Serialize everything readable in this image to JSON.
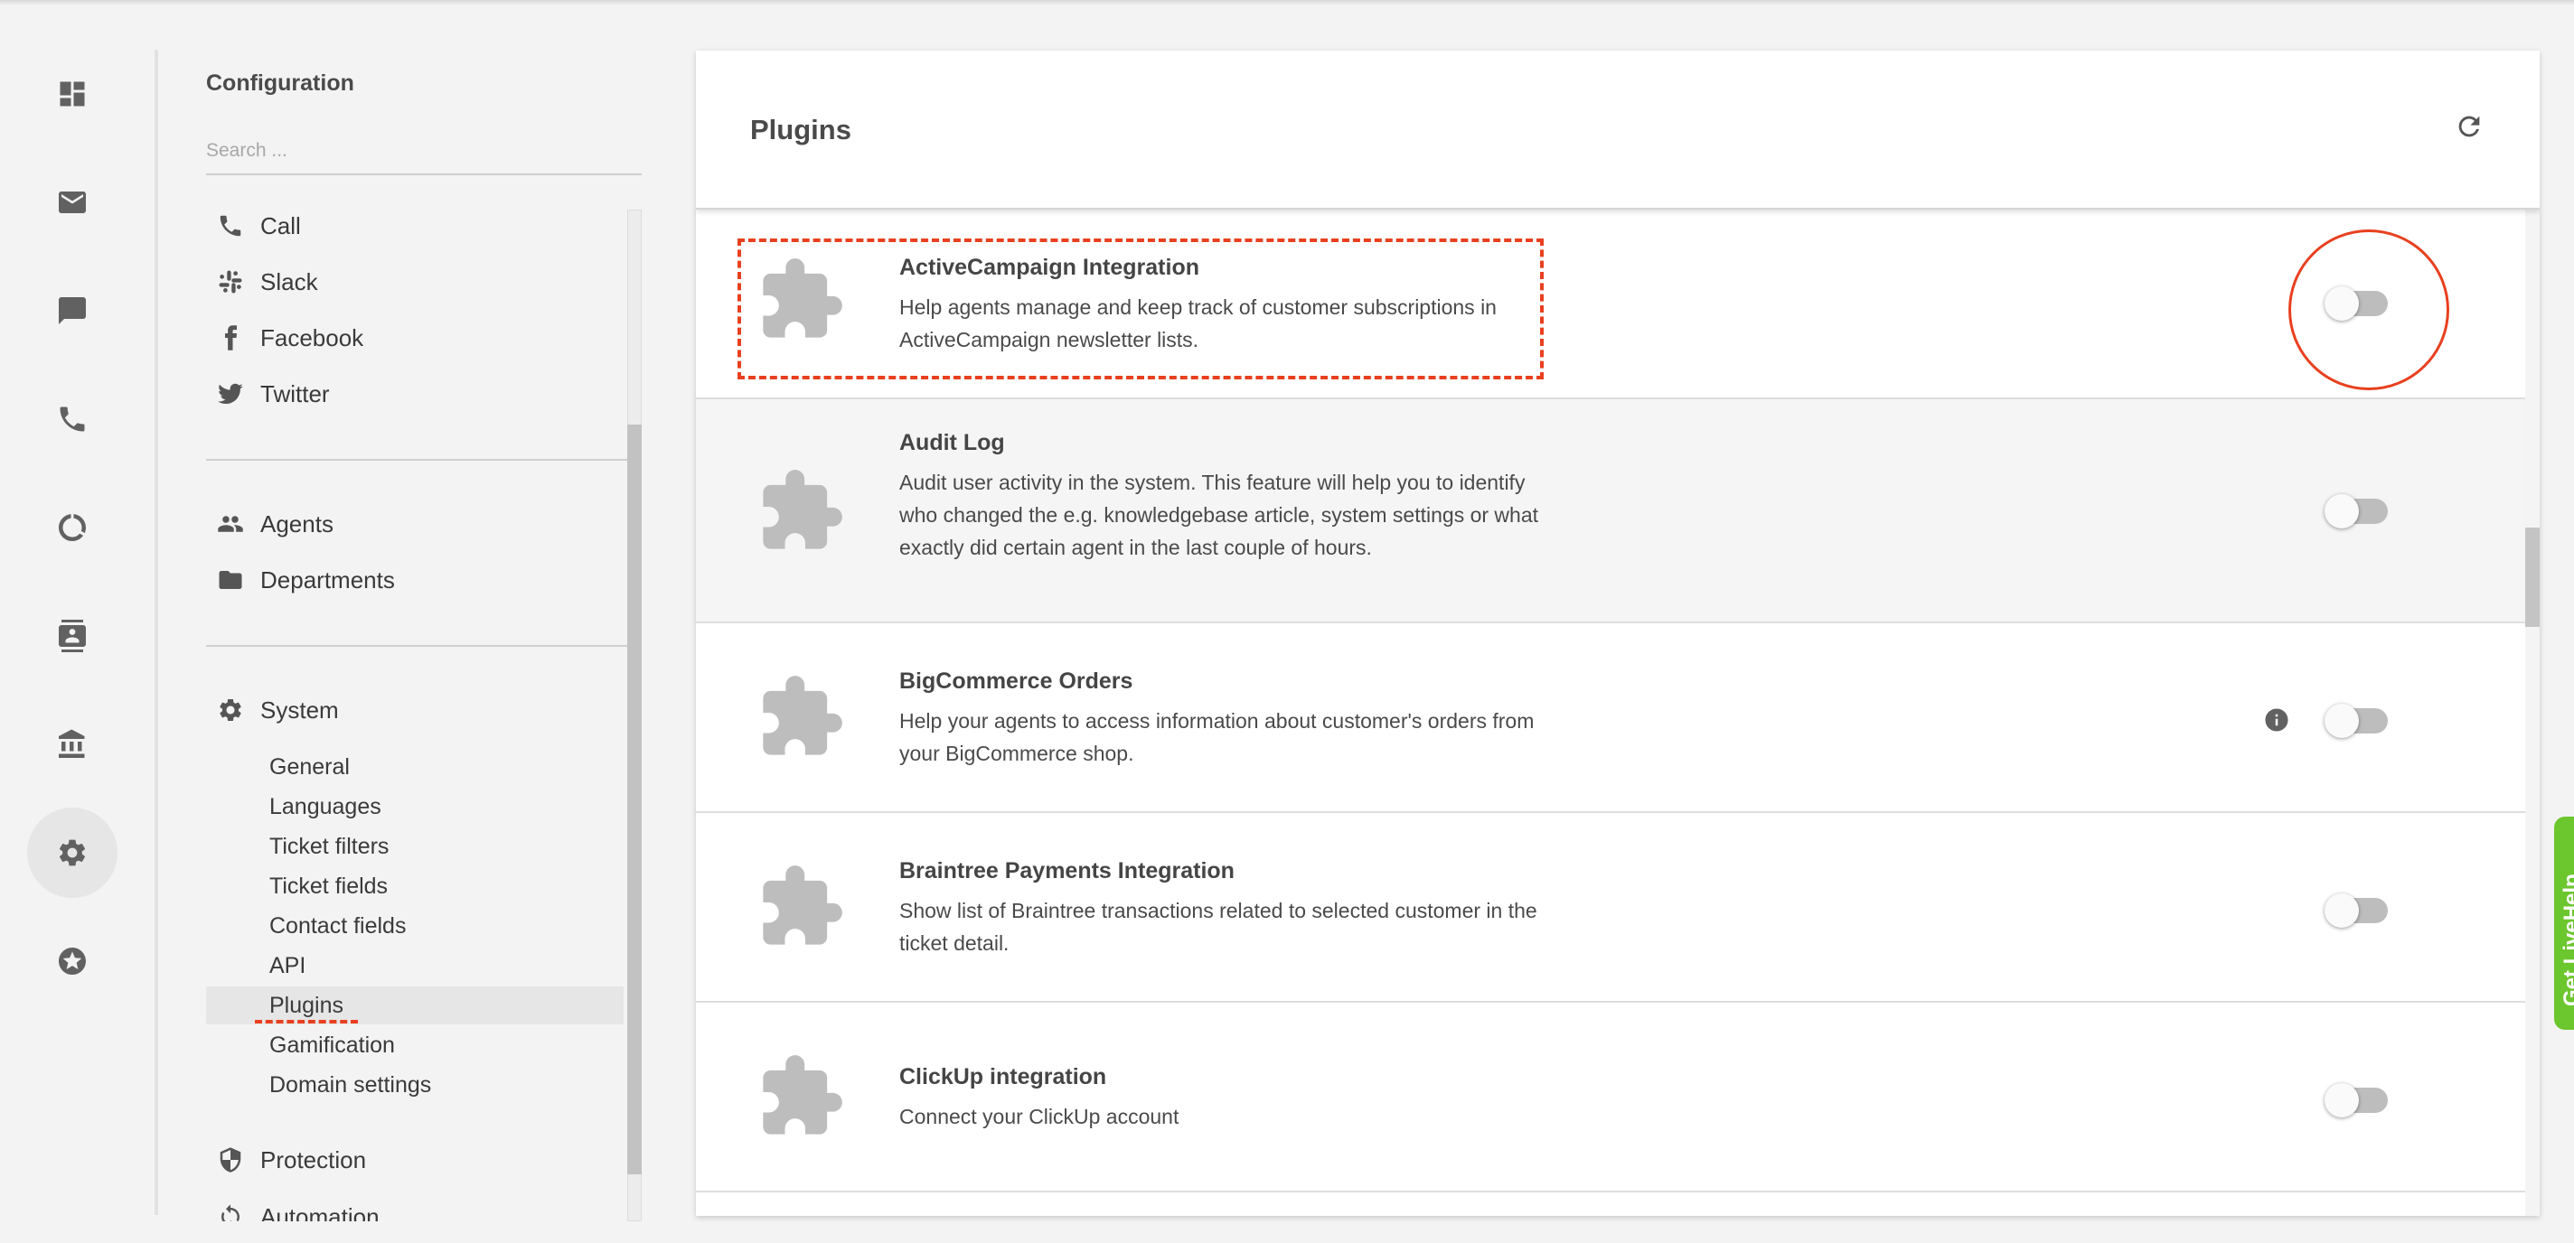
{
  "sidebar": {
    "title": "Configuration",
    "search_placeholder": "Search ...",
    "channels": [
      {
        "label": "Call",
        "icon": "phone-icon"
      },
      {
        "label": "Slack",
        "icon": "slack-icon"
      },
      {
        "label": "Facebook",
        "icon": "facebook-icon"
      },
      {
        "label": "Twitter",
        "icon": "twitter-icon"
      }
    ],
    "people": [
      {
        "label": "Agents",
        "icon": "people-icon"
      },
      {
        "label": "Departments",
        "icon": "folder-icon"
      }
    ],
    "system": {
      "label": "System",
      "icon": "gear-icon"
    },
    "system_items": [
      "General",
      "Languages",
      "Ticket filters",
      "Ticket fields",
      "Contact fields",
      "API",
      "Plugins",
      "Gamification",
      "Domain settings"
    ],
    "active_item": "Plugins",
    "protection": {
      "label": "Protection",
      "icon": "shield-icon"
    },
    "automation": {
      "label": "Automation",
      "icon": "sync-icon"
    }
  },
  "rail": [
    {
      "icon": "dashboard-icon"
    },
    {
      "icon": "mail-icon"
    },
    {
      "icon": "chat-icon"
    },
    {
      "icon": "phone-icon"
    },
    {
      "icon": "reports-icon"
    },
    {
      "icon": "contacts-icon"
    },
    {
      "icon": "knowledgebase-icon"
    },
    {
      "icon": "settings-icon",
      "active": true
    },
    {
      "icon": "star-icon"
    }
  ],
  "panel": {
    "title": "Plugins",
    "plugins": [
      {
        "name": "ActiveCampaign Integration",
        "desc": "Help agents manage and keep track of customer subscriptions in ActiveCampaign newsletter lists.",
        "enabled": false,
        "info": false
      },
      {
        "name": "Audit Log",
        "desc": "Audit user activity in the system. This feature will help you to identify who changed the e.g. knowledgebase article, system settings or what exactly did certain agent in the last couple of hours.",
        "enabled": false,
        "info": false
      },
      {
        "name": "BigCommerce Orders",
        "desc": "Help your agents to access information about customer's orders from your BigCommerce shop.",
        "enabled": false,
        "info": true
      },
      {
        "name": "Braintree Payments Integration",
        "desc": "Show list of Braintree transactions related to selected customer in the ticket detail.",
        "enabled": false,
        "info": false
      },
      {
        "name": "ClickUp integration",
        "desc": "Connect your ClickUp account",
        "enabled": false,
        "info": false
      }
    ]
  },
  "help_tab": "Get LiveHelp",
  "colors": {
    "annotation": "#e8401f",
    "help_tab": "#6cc62e"
  }
}
